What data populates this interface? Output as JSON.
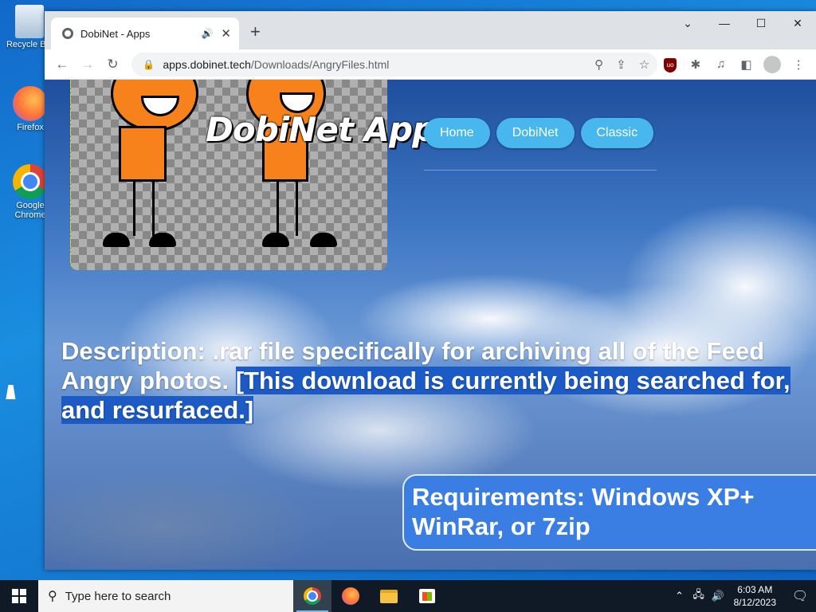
{
  "desktop": {
    "icons": [
      {
        "label": "Recycle Bin"
      },
      {
        "label": "Firefox"
      },
      {
        "label": "Google Chrome"
      }
    ]
  },
  "browser": {
    "tab": {
      "title": "DobiNet - Apps",
      "audio_icon": "speaker-icon",
      "close_icon": "close-icon"
    },
    "window_controls": {
      "minimize": "—",
      "maximize": "☐",
      "close": "✕"
    },
    "address": {
      "host": "apps.dobinet.tech",
      "path": "/Downloads/AngryFiles.html"
    }
  },
  "page": {
    "logo": "DobiNet Apps",
    "nav": [
      "Home",
      "DobiNet",
      "Classic"
    ],
    "description_plain": "Description: .rar file specifically for archiving all of the Feed Angry photos. ",
    "description_selected": "[This download is currently being searched for, and resurfaced.]",
    "requirements_line1": "Requirements: Windows XP+",
    "requirements_line2": "WinRar, or 7zip"
  },
  "taskbar": {
    "search_placeholder": "Type here to search",
    "time": "6:03 AM",
    "date": "8/12/2023"
  },
  "colors": {
    "nav_button": "#47b7ee",
    "selection": "#1c5bc6",
    "requirements_box": "#3a7ee3",
    "character_orange": "#f7821b"
  }
}
